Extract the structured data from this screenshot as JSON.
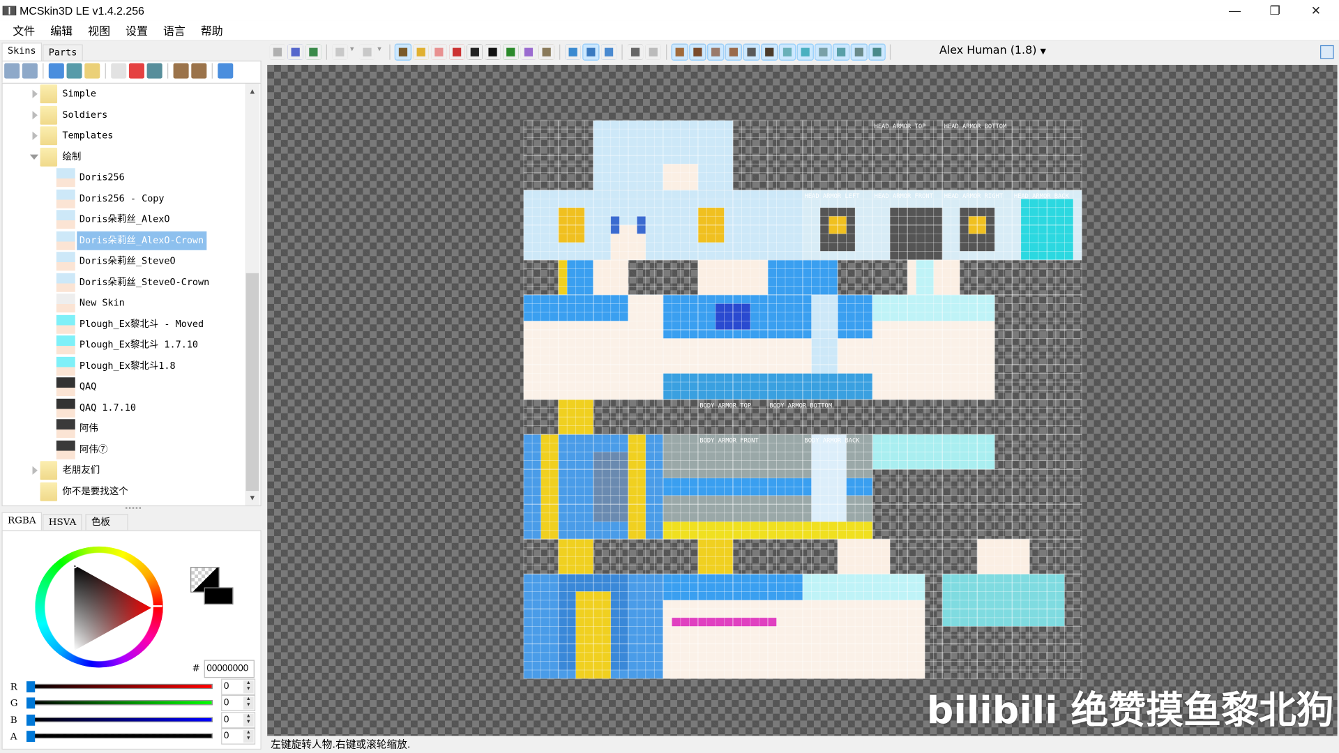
{
  "window": {
    "title": "MCSkin3D LE v1.4.2.256",
    "minimize": "—",
    "restore": "❐",
    "close": "✕"
  },
  "menu": [
    "文件",
    "编辑",
    "视图",
    "设置",
    "语言",
    "帮助"
  ],
  "left_tabs": [
    "Skins",
    "Parts"
  ],
  "left_toolbar": [
    "zoom-out-icon",
    "zoom-in-icon",
    "|",
    "import-icon",
    "new-skin-icon",
    "new-folder-icon",
    "|",
    "rename-icon",
    "delete-icon",
    "clone-skin-icon",
    "|",
    "grid-large-icon",
    "grid-small-icon",
    "|",
    "upload-icon"
  ],
  "tree": [
    {
      "label": "Simple",
      "type": "folder",
      "expanded": false,
      "depth": 0
    },
    {
      "label": "Soldiers",
      "type": "folder",
      "expanded": false,
      "depth": 0
    },
    {
      "label": "Templates",
      "type": "folder",
      "expanded": false,
      "depth": 0
    },
    {
      "label": "绘制",
      "type": "folder",
      "expanded": true,
      "depth": 0
    },
    {
      "label": "Doris256",
      "type": "skin",
      "depth": 1,
      "thumb": "#cde8f8"
    },
    {
      "label": "Doris256 - Copy",
      "type": "skin",
      "depth": 1,
      "thumb": "#cde8f8"
    },
    {
      "label": "Doris朵莉丝_AlexO",
      "type": "skin",
      "depth": 1,
      "thumb": "#cde8f8"
    },
    {
      "label": "Doris朵莉丝_AlexO-Crown",
      "type": "skin",
      "depth": 1,
      "thumb": "#cde8f8",
      "selected": true
    },
    {
      "label": "Doris朵莉丝_SteveO",
      "type": "skin",
      "depth": 1,
      "thumb": "#cde8f8"
    },
    {
      "label": "Doris朵莉丝_SteveO-Crown",
      "type": "skin",
      "depth": 1,
      "thumb": "#cde8f8"
    },
    {
      "label": "New Skin",
      "type": "skin",
      "depth": 1,
      "thumb": "#eeeeee"
    },
    {
      "label": "Plough_Ex黎北斗 - Moved",
      "type": "skin",
      "depth": 1,
      "thumb": "#7ff0f8"
    },
    {
      "label": "Plough_Ex黎北斗 1.7.10",
      "type": "skin",
      "depth": 1,
      "thumb": "#7ff0f8"
    },
    {
      "label": "Plough_Ex黎北斗1.8",
      "type": "skin",
      "depth": 1,
      "thumb": "#7ff0f8"
    },
    {
      "label": "QAQ",
      "type": "skin",
      "depth": 1,
      "thumb": "#333333"
    },
    {
      "label": "QAQ 1.7.10",
      "type": "skin",
      "depth": 1,
      "thumb": "#333333"
    },
    {
      "label": "阿伟",
      "type": "skin",
      "depth": 1,
      "thumb": "#3a3a3a"
    },
    {
      "label": "阿伟⑦",
      "type": "skin",
      "depth": 1,
      "thumb": "#3a3a3a"
    },
    {
      "label": "老朋友们",
      "type": "folder",
      "expanded": false,
      "depth": 0
    },
    {
      "label": "你不是要找这个",
      "type": "folder",
      "depth": 0
    }
  ],
  "color_tabs": [
    "RGBA",
    "HSVA",
    "色板"
  ],
  "color": {
    "hex_label": "#",
    "hex": "00000000",
    "channels": [
      {
        "label": "R",
        "value": "0",
        "color": "#ff0000"
      },
      {
        "label": "G",
        "value": "0",
        "color": "#00ff00"
      },
      {
        "label": "B",
        "value": "0",
        "color": "#0000ff"
      },
      {
        "label": "A",
        "value": "0",
        "color": "#000000"
      }
    ]
  },
  "main_toolbar": [
    {
      "name": "save-icon",
      "c": "#b0b0b0"
    },
    {
      "name": "save-all-icon",
      "c": "#5566cc"
    },
    {
      "name": "upload-globe-icon",
      "c": "#3a8a4a"
    },
    "|",
    {
      "name": "undo-icon",
      "c": "#c8c8c8"
    },
    {
      "name": "undo-dropdown-icon",
      "c": "#f0f0f0"
    },
    {
      "name": "redo-icon",
      "c": "#c8c8c8"
    },
    {
      "name": "redo-dropdown-icon",
      "c": "#f0f0f0"
    },
    "|",
    {
      "name": "camera-eye-icon",
      "c": "#7a5a2a",
      "on": true
    },
    {
      "name": "pencil-icon",
      "c": "#e0b030"
    },
    {
      "name": "eraser-icon",
      "c": "#e89090"
    },
    {
      "name": "dropper-icon",
      "c": "#cc3333"
    },
    {
      "name": "dodge-burn-icon",
      "c": "#222"
    },
    {
      "name": "darken-lighten-icon",
      "c": "#111"
    },
    {
      "name": "bucket-icon",
      "c": "#2a8a2a"
    },
    {
      "name": "noise-icon",
      "c": "#9a6ad0"
    },
    {
      "name": "stamp-icon",
      "c": "#8a7a5a"
    },
    "|",
    {
      "name": "player-model-icon",
      "c": "#3a8ad0"
    },
    {
      "name": "texture-mode-icon",
      "c": "#3a7ac0",
      "on": true
    },
    {
      "name": "both-mode-icon",
      "c": "#4a8ad0"
    },
    "|",
    {
      "name": "center-view-icon",
      "c": "#666"
    },
    {
      "name": "background-icon",
      "c": "#bbb"
    },
    "|",
    {
      "name": "toggle-head-icon",
      "c": "#a06a3a",
      "on": true
    },
    {
      "name": "toggle-body-icon",
      "c": "#7a4a2a",
      "on": true
    },
    {
      "name": "toggle-left-arm-icon",
      "c": "#9a7a6a",
      "on": true
    },
    {
      "name": "toggle-right-arm-icon",
      "c": "#9a6a4a",
      "on": true
    },
    {
      "name": "toggle-left-leg-icon",
      "c": "#5a5a5a",
      "on": true
    },
    {
      "name": "toggle-right-leg-icon",
      "c": "#4a3a2a",
      "on": true
    },
    {
      "name": "toggle-helmet-icon",
      "c": "#6ab0b8",
      "on": true
    },
    {
      "name": "toggle-chest-icon",
      "c": "#4ab0c0",
      "on": true
    },
    {
      "name": "toggle-left-sleeve-icon",
      "c": "#7aa0a8",
      "on": true
    },
    {
      "name": "toggle-right-sleeve-icon",
      "c": "#5aa0a8",
      "on": true
    },
    {
      "name": "toggle-left-pant-icon",
      "c": "#6a8a8a",
      "on": true
    },
    {
      "name": "toggle-right-pant-icon",
      "c": "#4a8a8a",
      "on": true
    },
    "|"
  ],
  "model_select": "Alex Human (1.8)",
  "texture_labels": [
    {
      "t": "HEAD ARMOR TOP",
      "u": [
        40,
        0
      ]
    },
    {
      "t": "HEAD ARMOR BOTTOM",
      "u": [
        48,
        0
      ]
    },
    {
      "t": "HEAD ARMOR LEFT",
      "u": [
        32,
        8
      ]
    },
    {
      "t": "HEAD ARMOR FRONT",
      "u": [
        40,
        8
      ]
    },
    {
      "t": "HEAD ARMOR RIGHT",
      "u": [
        48,
        8
      ]
    },
    {
      "t": "HEAD ARMOR BACK",
      "u": [
        56,
        8
      ]
    },
    {
      "t": "BODY ARMOR TOP",
      "u": [
        20,
        32
      ]
    },
    {
      "t": "BODY ARMOR BOTTOM",
      "u": [
        28,
        32
      ]
    },
    {
      "t": "BODY ARMOR FRONT",
      "u": [
        20,
        36
      ]
    },
    {
      "t": "BODY ARMOR BACK",
      "u": [
        32,
        36
      ]
    }
  ],
  "status": "左键旋转人物.右键或滚轮缩放.",
  "watermark": "bilibili 绝赞摸鱼黎北狗"
}
